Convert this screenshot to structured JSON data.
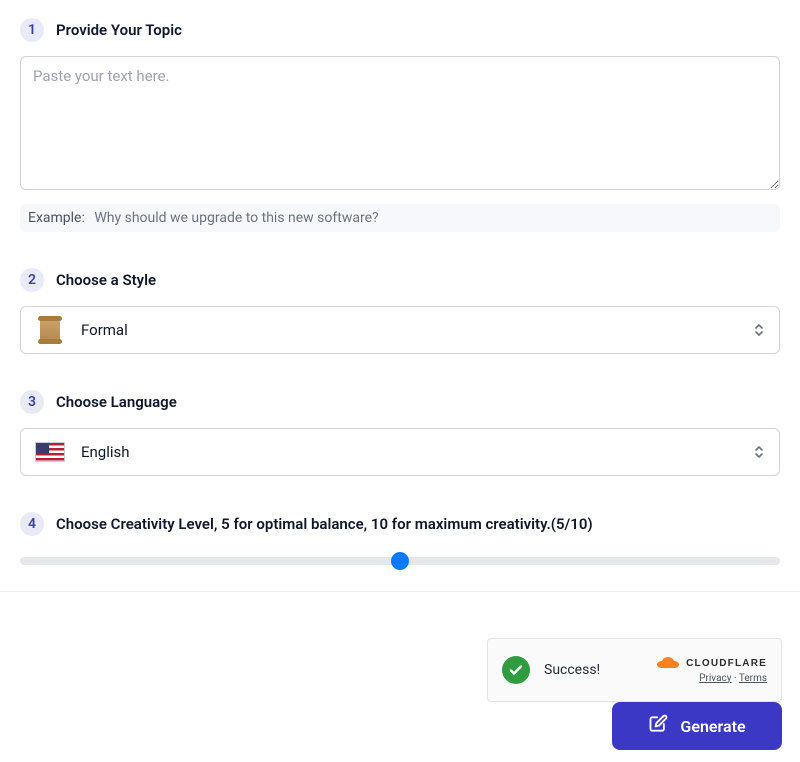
{
  "steps": {
    "topic": {
      "number": "1",
      "title": "Provide Your Topic",
      "placeholder": "Paste your text here.",
      "example_label": "Example:",
      "example_text": "Why should we upgrade to this new software?"
    },
    "style": {
      "number": "2",
      "title": "Choose a Style",
      "value": "Formal",
      "icon": "scroll-icon"
    },
    "language": {
      "number": "3",
      "title": "Choose Language",
      "value": "English",
      "icon": "us-flag-icon"
    },
    "creativity": {
      "number": "4",
      "title": "Choose Creativity Level, 5 for optimal balance, 10 for maximum creativity.(5/10)",
      "min": 0,
      "max": 10,
      "value": 5
    }
  },
  "turnstile": {
    "status": "Success!",
    "brand": "CLOUDFLARE",
    "privacy": "Privacy",
    "terms": "Terms",
    "dot": "·"
  },
  "actions": {
    "generate": "Generate"
  },
  "colors": {
    "accent": "#3b38c6",
    "slider_thumb": "#0a7bff",
    "success": "#2e9c3f"
  }
}
